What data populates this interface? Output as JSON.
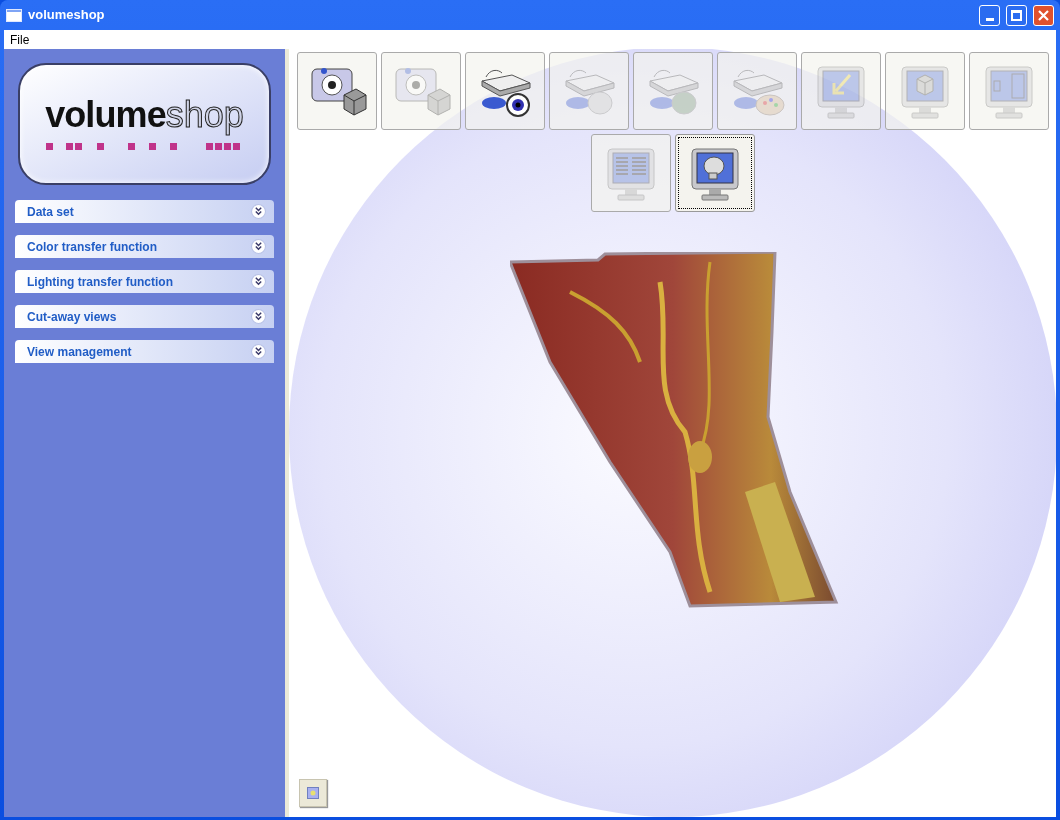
{
  "window": {
    "title": "volumeshop"
  },
  "menu": [
    "File"
  ],
  "logo": {
    "word_bold": "volume",
    "word_light": "shop"
  },
  "panels": [
    {
      "label": "Data set",
      "expanded": false
    },
    {
      "label": "Color transfer function",
      "expanded": false
    },
    {
      "label": "Lighting transfer function",
      "expanded": false
    },
    {
      "label": "Cut-away views",
      "expanded": false
    },
    {
      "label": "View management",
      "expanded": false
    }
  ],
  "toolbar": [
    {
      "kind": "camera-cube",
      "disabled": false,
      "selected": false
    },
    {
      "kind": "camera-cube",
      "disabled": true,
      "selected": false
    },
    {
      "kind": "scanner-eye",
      "disabled": false,
      "selected": false
    },
    {
      "kind": "scanner-skull",
      "disabled": true,
      "selected": false
    },
    {
      "kind": "scanner-brain",
      "disabled": true,
      "selected": false
    },
    {
      "kind": "scanner-palette",
      "disabled": true,
      "selected": false
    },
    {
      "kind": "monitor-arrow",
      "disabled": true,
      "selected": false
    },
    {
      "kind": "monitor-cube",
      "disabled": true,
      "selected": false
    },
    {
      "kind": "monitor-panels",
      "disabled": true,
      "selected": false
    },
    {
      "kind": "monitor-table",
      "disabled": true,
      "selected": false
    },
    {
      "kind": "monitor-skull",
      "disabled": false,
      "selected": true
    }
  ]
}
